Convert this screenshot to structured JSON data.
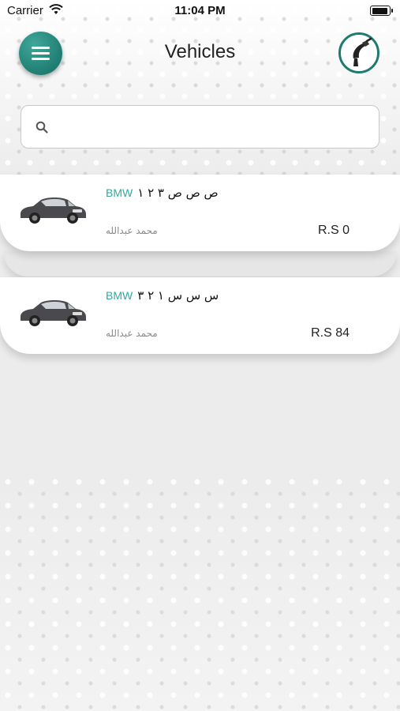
{
  "status": {
    "carrier": "Carrier",
    "time": "11:04 PM"
  },
  "header": {
    "title": "Vehicles",
    "menu_icon": "hamburger-menu-icon",
    "fuel_icon": "fuel-nozzle-icon"
  },
  "search": {
    "placeholder": "",
    "value": ""
  },
  "colors": {
    "accent": "#1f7a6f",
    "brand_text": "#2eaaa0"
  },
  "vehicles": [
    {
      "brand": "BMW",
      "plate": "ص ص ص ٣ ٢ ١",
      "owner": "محمد عبدالله",
      "price": "R.S 0"
    },
    {
      "brand": "BMW",
      "plate": "س س س ١ ٢ ٣",
      "owner": "محمد عبدالله",
      "price": "R.S 84"
    }
  ]
}
